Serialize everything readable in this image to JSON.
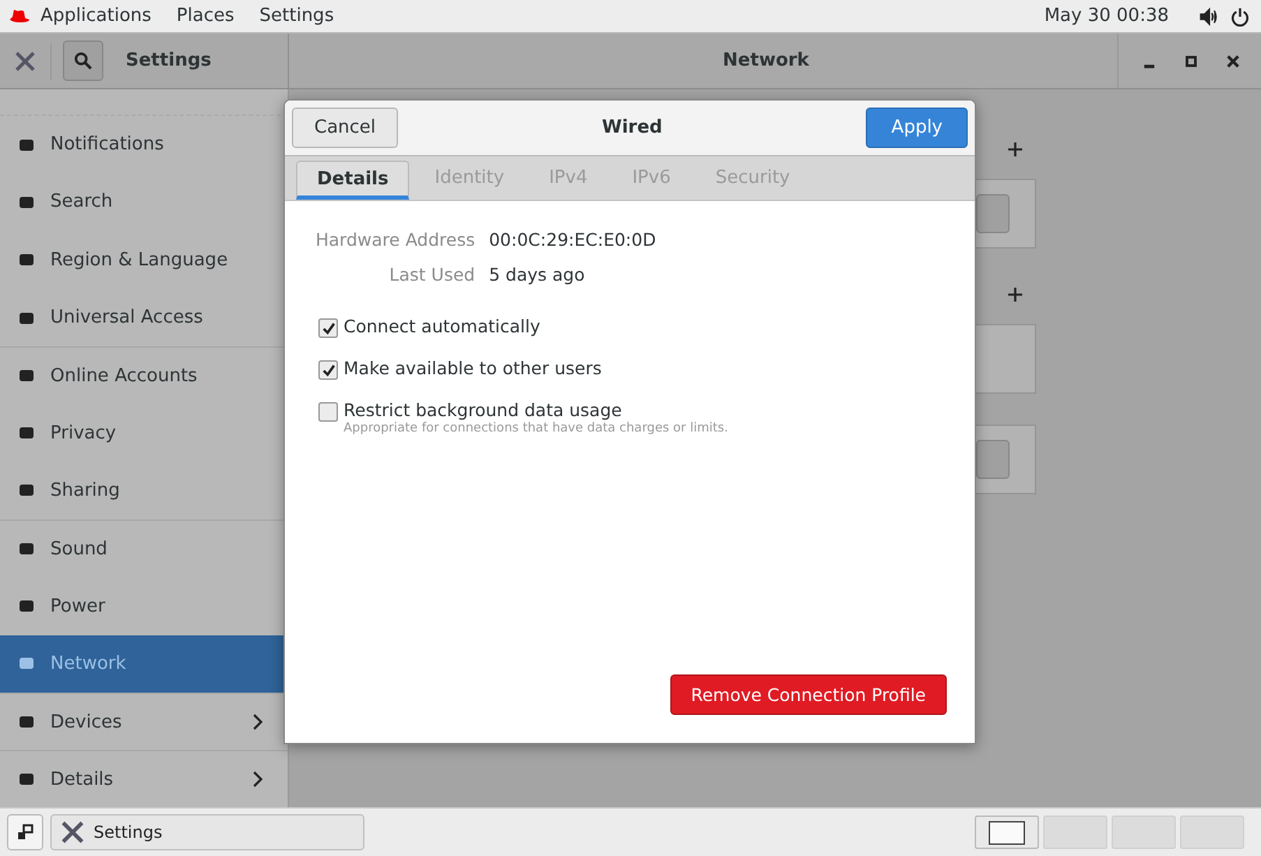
{
  "top_bar": {
    "menus": [
      "Applications",
      "Places",
      "Settings"
    ],
    "clock": "May 30  00:38"
  },
  "header": {
    "title": "Settings",
    "panel_title": "Network"
  },
  "sidebar": {
    "items": [
      {
        "label": "Notifications",
        "selected": false,
        "submenu": false
      },
      {
        "label": "Search",
        "selected": false,
        "submenu": false
      },
      {
        "label": "Region & Language",
        "selected": false,
        "submenu": false
      },
      {
        "label": "Universal Access",
        "selected": false,
        "submenu": false
      },
      {
        "label": "Online Accounts",
        "selected": false,
        "submenu": false
      },
      {
        "label": "Privacy",
        "selected": false,
        "submenu": false
      },
      {
        "label": "Sharing",
        "selected": false,
        "submenu": false
      },
      {
        "label": "Sound",
        "selected": false,
        "submenu": false
      },
      {
        "label": "Power",
        "selected": false,
        "submenu": false
      },
      {
        "label": "Network",
        "selected": true,
        "submenu": false
      },
      {
        "label": "Devices",
        "selected": false,
        "submenu": true
      },
      {
        "label": "Details",
        "selected": false,
        "submenu": true
      }
    ]
  },
  "dialog": {
    "title": "Wired",
    "cancel": "Cancel",
    "apply": "Apply",
    "tabs": [
      {
        "label": "Details",
        "selected": true
      },
      {
        "label": "Identity",
        "selected": false
      },
      {
        "label": "IPv4",
        "selected": false
      },
      {
        "label": "IPv6",
        "selected": false
      },
      {
        "label": "Security",
        "selected": false
      }
    ],
    "details": [
      {
        "label": "Hardware Address",
        "value": "00:0C:29:EC:E0:0D"
      },
      {
        "label": "Last Used",
        "value": "5 days ago"
      }
    ],
    "options": [
      {
        "label": "Connect automatically",
        "checked": true
      },
      {
        "label": "Make available to other users",
        "checked": true
      },
      {
        "label": "Restrict background data usage",
        "checked": false,
        "description": "Appropriate for connections that have data charges or limits."
      }
    ],
    "remove": "Remove Connection Profile"
  },
  "taskbar": {
    "window_label": "Settings",
    "workspaces": [
      {
        "selected": true
      },
      {
        "selected": false
      },
      {
        "selected": false
      },
      {
        "selected": false
      }
    ]
  }
}
